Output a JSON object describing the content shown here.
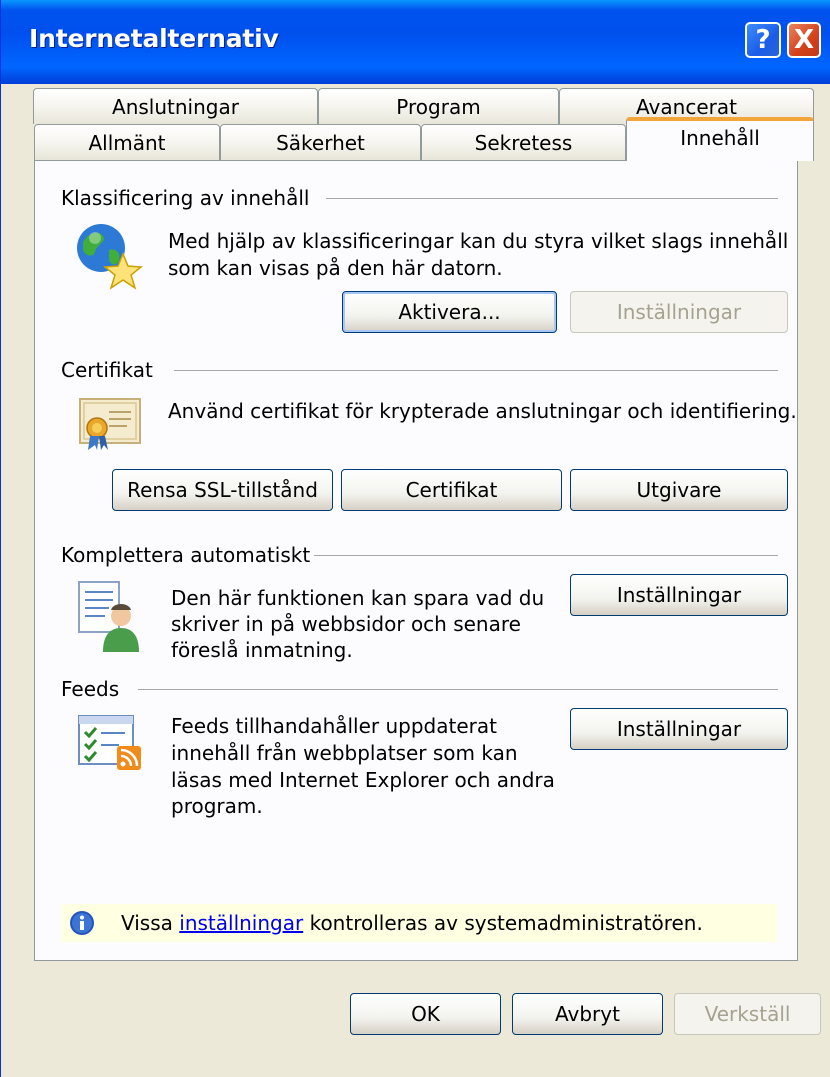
{
  "window": {
    "title": "Internetalternativ",
    "help_label": "?",
    "close_label": "X"
  },
  "tabs_row1": [
    "Anslutningar",
    "Program",
    "Avancerat"
  ],
  "tabs_row2": [
    "Allmänt",
    "Säkerhet",
    "Sekretess",
    "Innehåll"
  ],
  "active_tab": "Innehåll",
  "content_advisor": {
    "title": "Klassificering av innehåll",
    "description_line1": "Med hjälp av klassificeringar kan du styra vilket slags innehåll",
    "description_line2": "som kan visas på den här datorn.",
    "enable_button": "Aktivera...",
    "settings_button": "Inställningar"
  },
  "certificates": {
    "title": "Certifikat",
    "description": "Använd certifikat för krypterade anslutningar och identifiering.",
    "clear_ssl_button": "Rensa SSL-tillstånd",
    "certificates_button": "Certifikat",
    "publishers_button": "Utgivare"
  },
  "autocomplete": {
    "title": "Komplettera automatiskt",
    "description_line1": "Den här funktionen kan spara vad du",
    "description_line2": "skriver in på webbsidor och senare",
    "description_line3": "föreslå inmatning.",
    "settings_button": "Inställningar"
  },
  "feeds": {
    "title": "Feeds",
    "description_line1": "Feeds tillhandahåller uppdaterat",
    "description_line2": "innehåll från webbplatser som kan",
    "description_line3": "läsas med Internet Explorer och andra",
    "description_line4": "program.",
    "settings_button": "Inställningar"
  },
  "info": {
    "prefix": "Vissa ",
    "link": "inställningar",
    "suffix": " kontrolleras av systemadministratören."
  },
  "footer": {
    "ok": "OK",
    "cancel": "Avbryt",
    "apply": "Verkställ"
  },
  "icons": [
    "globe-star-icon",
    "certificate-icon",
    "autocomplete-user-icon",
    "feeds-icon",
    "info-icon"
  ]
}
